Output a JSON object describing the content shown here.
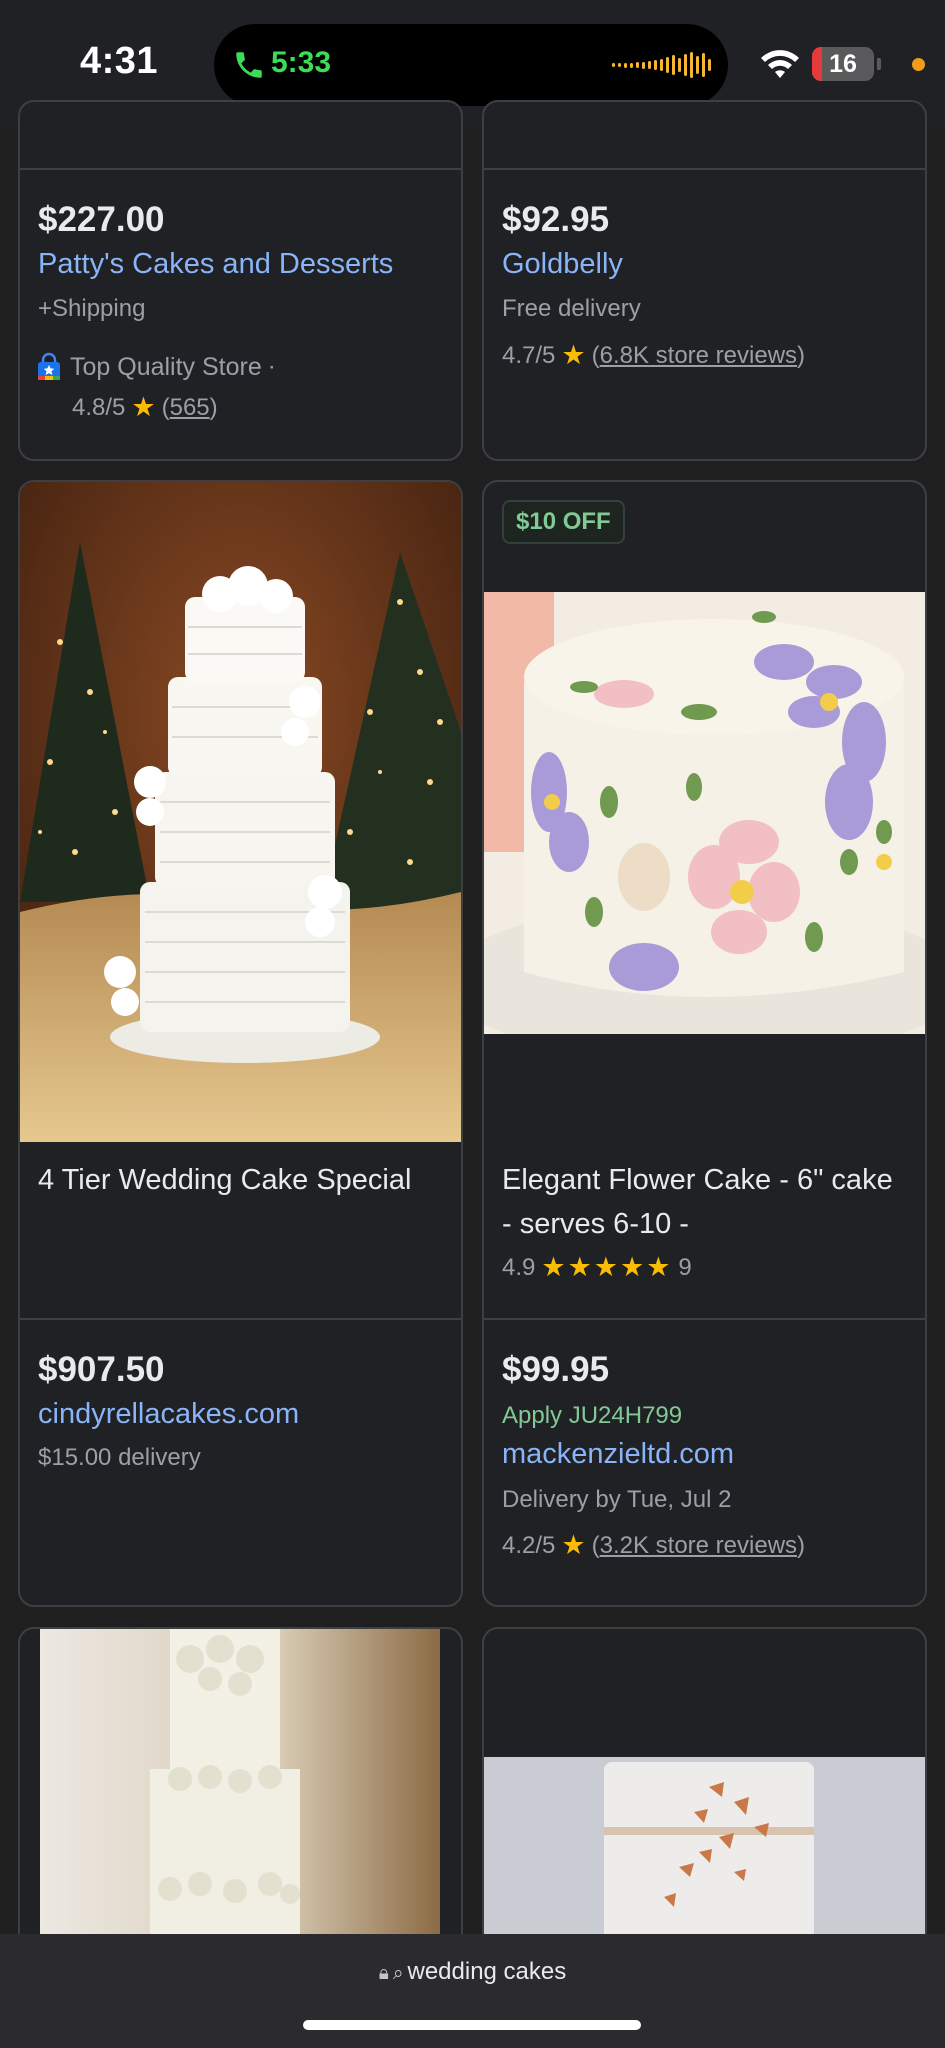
{
  "status_bar": {
    "time": "4:31",
    "call_time": "5:33",
    "battery": "16",
    "battery_level": 0.16,
    "colors": {
      "call": "#3ddc55",
      "battery_low": "#e5393b",
      "indicator": "#f29b1b"
    }
  },
  "products": [
    {
      "price": "$227.00",
      "seller": "Patty's Cakes and Desserts",
      "shipping": "+Shipping",
      "badge_text": "Top Quality Store",
      "badge_sep": "·",
      "rating": "4.8/5",
      "reviews": "565",
      "paren_open": "(",
      "paren_close": ")"
    },
    {
      "price": "$92.95",
      "seller": "Goldbelly",
      "shipping": "Free delivery",
      "rating": "4.7/5",
      "reviews": "6.8K store reviews",
      "paren_open": "(",
      "paren_close": ")"
    },
    {
      "title": "4 Tier Wedding Cake Special",
      "price": "$907.50",
      "seller": "cindyrellacakes.com",
      "shipping": "$15.00 delivery",
      "image_icon": "tiered-wedding-cake-icon"
    },
    {
      "discount": "$10 OFF",
      "title": "Elegant Flower Cake - 6\" cake - serves 6-10 -",
      "product_rating": "4.9",
      "stars": "★★★★★",
      "product_reviews": "9",
      "price": "$99.95",
      "promo": "Apply JU24H799",
      "seller": "mackenzieltd.com",
      "shipping": "Delivery by Tue, Jul 2",
      "rating": "4.2/5",
      "reviews": "3.2K store reviews",
      "paren_open": "(",
      "paren_close": ")",
      "image_icon": "flower-cake-icon"
    }
  ],
  "url_bar": {
    "query": "wedding cakes"
  },
  "icons": [
    "phone-icon",
    "wifi-icon",
    "lock-icon",
    "search-icon",
    "shopping-bag-icon",
    "star-icon"
  ]
}
